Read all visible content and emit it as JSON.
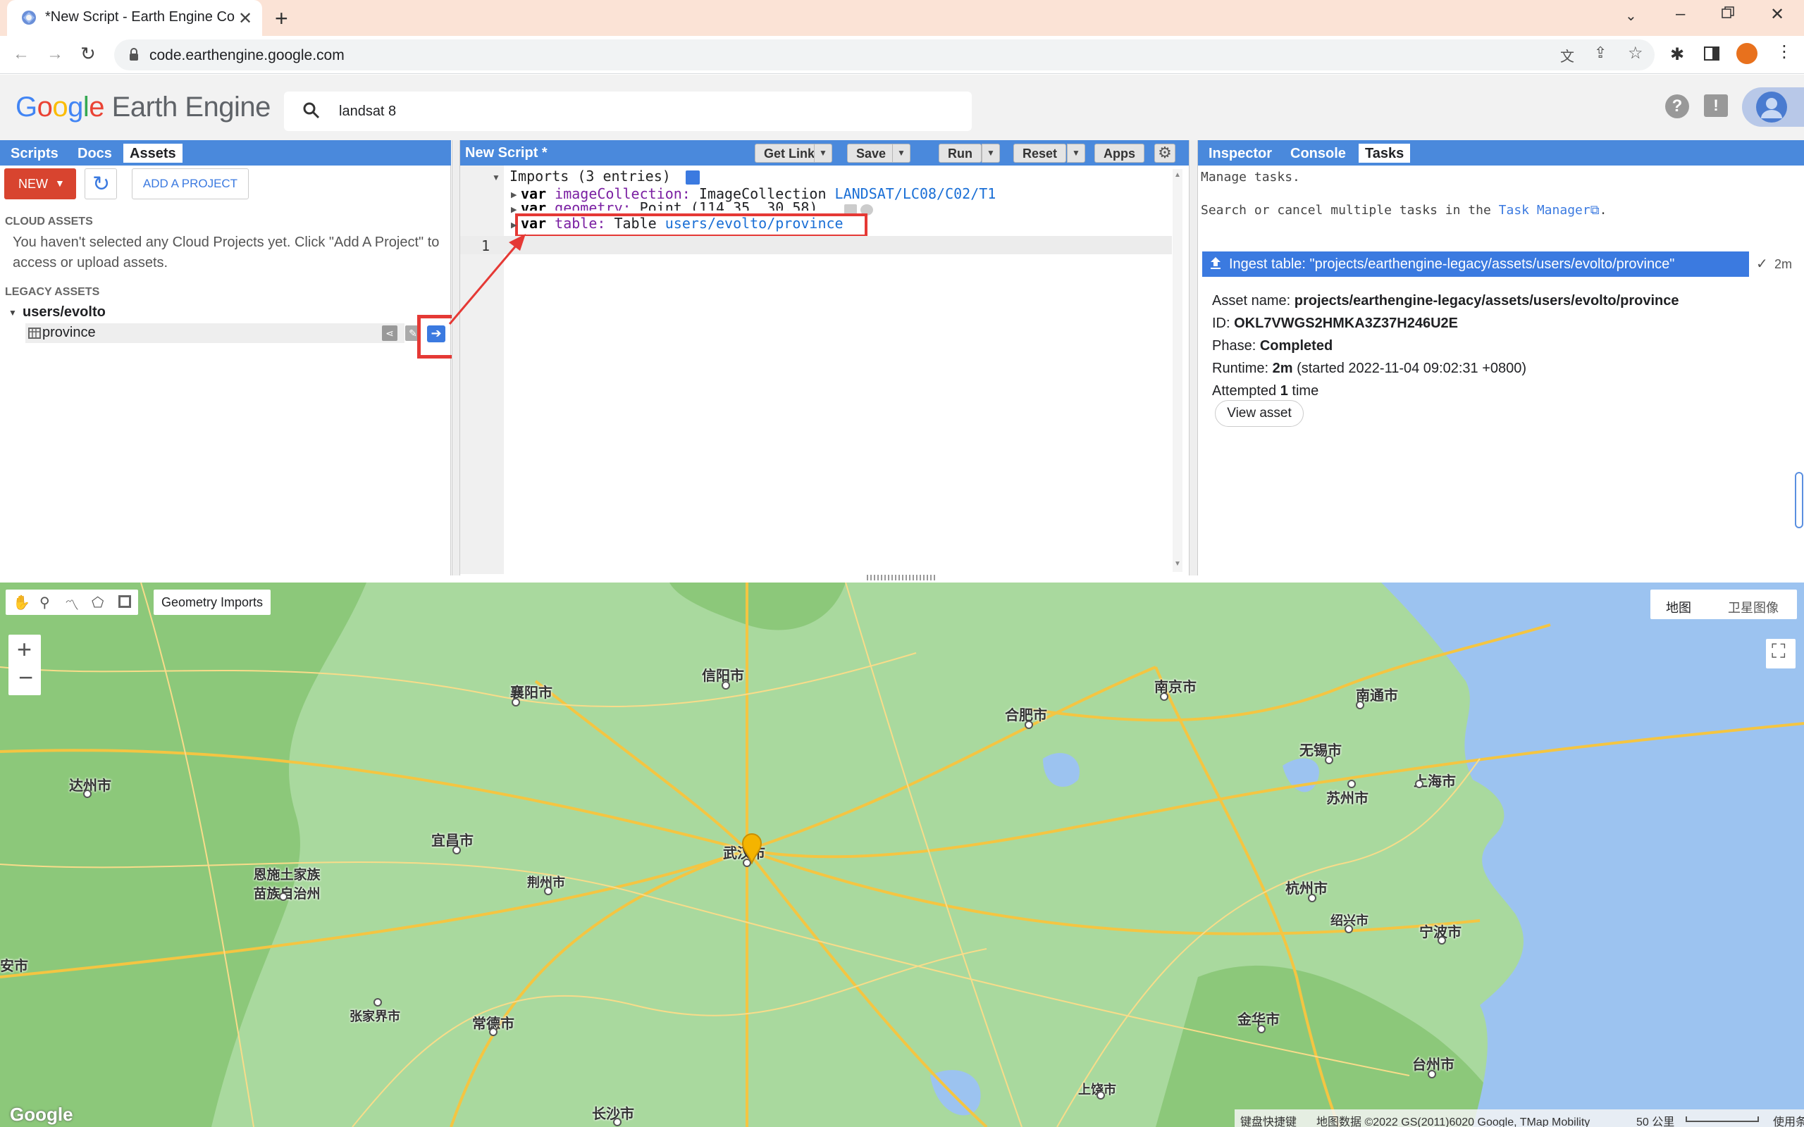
{
  "browser": {
    "tab_title": "*New Script - Earth Engine Co",
    "url": "code.earthengine.google.com"
  },
  "gee": {
    "logo_google": "Google",
    "logo_product": "Earth Engine",
    "search_value": "landsat 8"
  },
  "left_panel": {
    "tabs": [
      "Scripts",
      "Docs",
      "Assets"
    ],
    "new_button": "NEW",
    "add_project_button": "ADD A PROJECT",
    "cloud_assets_header": "CLOUD ASSETS",
    "cloud_assets_msg": "You haven't selected any Cloud Projects yet. Click \"Add A Project\" to access or upload assets.",
    "legacy_assets_header": "LEGACY ASSETS",
    "user_folder": "users/evolto",
    "asset_item": "province"
  },
  "editor": {
    "title": "New Script *",
    "buttons": {
      "get_link": "Get Link",
      "save": "Save",
      "run": "Run",
      "reset": "Reset",
      "apps": "Apps"
    },
    "imports_header": "Imports (3 entries)",
    "imports": [
      {
        "kw": "var",
        "name": "imageCollection:",
        "type": "ImageCollection",
        "value": "LANDSAT/LC08/C02/T1"
      },
      {
        "kw": "var",
        "name": "geometry:",
        "type": "Point",
        "value": "(114.35, 30.58)"
      },
      {
        "kw": "var",
        "name": "table:",
        "type": "Table",
        "value": "users/evolto/province"
      }
    ],
    "line_number": "1"
  },
  "right_panel": {
    "tabs": [
      "Inspector",
      "Console",
      "Tasks"
    ],
    "manage_tasks": "Manage tasks.",
    "search_cancel_prefix": "Search or cancel multiple tasks in the",
    "task_manager_link": "Task Manager",
    "task_title": "Ingest table: \"projects/earthengine-legacy/assets/users/evolto/province\"",
    "task_time": "2m",
    "asset_name_label": "Asset name:",
    "asset_name_value": "projects/earthengine-legacy/assets/users/evolto/province",
    "id_label": "ID:",
    "id_value": "OKL7VWGS2HMKA3Z37H246U2E",
    "phase_label": "Phase:",
    "phase_value": "Completed",
    "runtime_label": "Runtime:",
    "runtime_value": "2m",
    "runtime_started": "(started 2022-11-04 09:02:31 +0800)",
    "attempted_prefix": "Attempted",
    "attempted_count": "1",
    "attempted_suffix": "time",
    "view_asset_button": "View asset"
  },
  "map": {
    "geometry_imports": "Geometry Imports",
    "map_type_map": "地图",
    "map_type_satellite": "卫星图像",
    "google_logo": "Google",
    "footer_shortcuts": "键盘快捷键",
    "footer_data": "地图数据 ©2022 GS(2011)6020 Google, TMap Mobility",
    "footer_scale": "50 公里",
    "footer_terms": "使用条款",
    "cities": [
      "信阳市",
      "襄阳市",
      "合肥市",
      "南京市",
      "南通市",
      "达州市",
      "无锡市",
      "上海市",
      "苏州市",
      "宜昌市",
      "武汉市",
      "恩施土家族苗族自治州",
      "荆州市",
      "杭州市",
      "绍兴市",
      "宁波市",
      "安市",
      "张家界市",
      "常德市",
      "金华市",
      "台州市",
      "上饶市",
      "长沙市"
    ]
  }
}
